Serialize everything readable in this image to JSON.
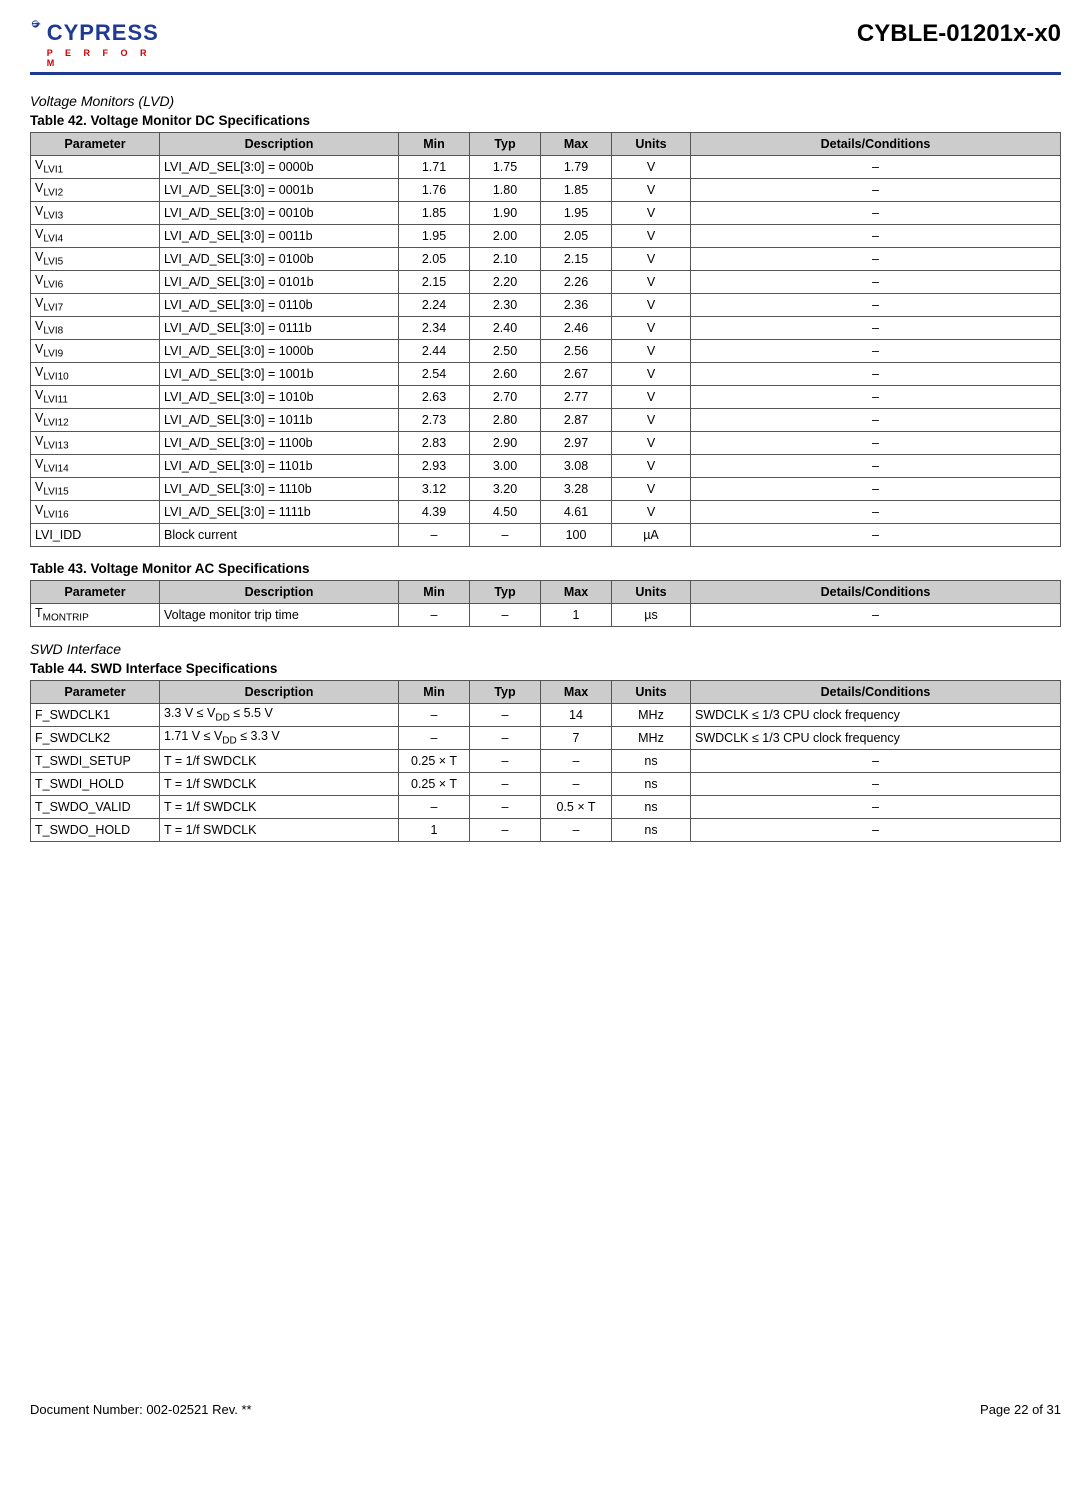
{
  "header": {
    "brand": "CYPRESS",
    "tagline": "P E R F O R M",
    "part": "CYBLE-01201x-x0"
  },
  "section1": {
    "heading": "Voltage Monitors (LVD)",
    "caption": "Table 42.  Voltage Monitor DC Specifications",
    "cols": [
      "Parameter",
      "Description",
      "Min",
      "Typ",
      "Max",
      "Units",
      "Details/Conditions"
    ],
    "rows": [
      {
        "pPre": "V",
        "pSub": "LVI1",
        "d": "LVI_A/D_SEL[3:0] = 0000b",
        "min": "1.71",
        "typ": "1.75",
        "max": "1.79",
        "u": "V",
        "c": "–"
      },
      {
        "pPre": "V",
        "pSub": "LVI2",
        "d": "LVI_A/D_SEL[3:0] = 0001b",
        "min": "1.76",
        "typ": "1.80",
        "max": "1.85",
        "u": "V",
        "c": "–"
      },
      {
        "pPre": "V",
        "pSub": "LVI3",
        "d": "LVI_A/D_SEL[3:0] = 0010b",
        "min": "1.85",
        "typ": "1.90",
        "max": "1.95",
        "u": "V",
        "c": "–"
      },
      {
        "pPre": "V",
        "pSub": "LVI4",
        "d": "LVI_A/D_SEL[3:0] = 0011b",
        "min": "1.95",
        "typ": "2.00",
        "max": "2.05",
        "u": "V",
        "c": "–"
      },
      {
        "pPre": "V",
        "pSub": "LVI5",
        "d": "LVI_A/D_SEL[3:0] = 0100b",
        "min": "2.05",
        "typ": "2.10",
        "max": "2.15",
        "u": "V",
        "c": "–"
      },
      {
        "pPre": "V",
        "pSub": "LVI6",
        "d": "LVI_A/D_SEL[3:0] = 0101b",
        "min": "2.15",
        "typ": "2.20",
        "max": "2.26",
        "u": "V",
        "c": "–"
      },
      {
        "pPre": "V",
        "pSub": "LVI7",
        "d": "LVI_A/D_SEL[3:0] = 0110b",
        "min": "2.24",
        "typ": "2.30",
        "max": "2.36",
        "u": "V",
        "c": "–"
      },
      {
        "pPre": "V",
        "pSub": "LVI8",
        "d": "LVI_A/D_SEL[3:0] = 0111b",
        "min": "2.34",
        "typ": "2.40",
        "max": "2.46",
        "u": "V",
        "c": "–"
      },
      {
        "pPre": "V",
        "pSub": "LVI9",
        "d": "LVI_A/D_SEL[3:0] = 1000b",
        "min": "2.44",
        "typ": "2.50",
        "max": "2.56",
        "u": "V",
        "c": "–"
      },
      {
        "pPre": "V",
        "pSub": "LVI10",
        "d": "LVI_A/D_SEL[3:0] = 1001b",
        "min": "2.54",
        "typ": "2.60",
        "max": "2.67",
        "u": "V",
        "c": "–"
      },
      {
        "pPre": "V",
        "pSub": "LVI11",
        "d": "LVI_A/D_SEL[3:0] = 1010b",
        "min": "2.63",
        "typ": "2.70",
        "max": "2.77",
        "u": "V",
        "c": "–"
      },
      {
        "pPre": "V",
        "pSub": "LVI12",
        "d": "LVI_A/D_SEL[3:0] = 1011b",
        "min": "2.73",
        "typ": "2.80",
        "max": "2.87",
        "u": "V",
        "c": "–"
      },
      {
        "pPre": "V",
        "pSub": "LVI13",
        "d": "LVI_A/D_SEL[3:0] = 1100b",
        "min": "2.83",
        "typ": "2.90",
        "max": "2.97",
        "u": "V",
        "c": "–"
      },
      {
        "pPre": "V",
        "pSub": "LVI14",
        "d": "LVI_A/D_SEL[3:0] = 1101b",
        "min": "2.93",
        "typ": "3.00",
        "max": "3.08",
        "u": "V",
        "c": "–"
      },
      {
        "pPre": "V",
        "pSub": "LVI15",
        "d": "LVI_A/D_SEL[3:0] = 1110b",
        "min": "3.12",
        "typ": "3.20",
        "max": "3.28",
        "u": "V",
        "c": "–"
      },
      {
        "pPre": "V",
        "pSub": "LVI16",
        "d": "LVI_A/D_SEL[3:0] = 1111b",
        "min": "4.39",
        "typ": "4.50",
        "max": "4.61",
        "u": "V",
        "c": "–"
      },
      {
        "pPre": "LVI_IDD",
        "pSub": "",
        "d": "Block current",
        "min": "–",
        "typ": "–",
        "max": "100",
        "u": "µA",
        "c": "–"
      }
    ]
  },
  "section2": {
    "caption": "Table 43.  Voltage Monitor AC Specifications",
    "cols": [
      "Parameter",
      "Description",
      "Min",
      "Typ",
      "Max",
      "Units",
      "Details/Conditions"
    ],
    "rows": [
      {
        "pPre": "T",
        "pSub": "MONTRIP",
        "d": "Voltage monitor trip time",
        "min": "–",
        "typ": "–",
        "max": "1",
        "u": "µs",
        "c": "–"
      }
    ]
  },
  "section3": {
    "heading": "SWD Interface",
    "caption": "Table 44.  SWD Interface Specifications",
    "cols": [
      "Parameter",
      "Description",
      "Min",
      "Typ",
      "Max",
      "Units",
      "Details/Conditions"
    ],
    "rows": [
      {
        "pPre": "F_SWDCLK1",
        "pSub": "",
        "dHtml": "3.3 V ≤ V<sub>DD</sub> ≤ 5.5 V",
        "min": "–",
        "typ": "–",
        "max": "14",
        "u": "MHz",
        "c": "SWDCLK ≤ 1/3 CPU clock frequency"
      },
      {
        "pPre": "F_SWDCLK2",
        "pSub": "",
        "dHtml": "1.71 V ≤ V<sub>DD</sub> ≤ 3.3 V",
        "min": "–",
        "typ": "–",
        "max": "7",
        "u": "MHz",
        "c": "SWDCLK ≤ 1/3 CPU clock frequency"
      },
      {
        "pPre": "T_SWDI_SETUP",
        "pSub": "",
        "d": "T = 1/f SWDCLK",
        "min": "0.25 × T",
        "typ": "–",
        "max": "–",
        "u": "ns",
        "c": "–"
      },
      {
        "pPre": "T_SWDI_HOLD",
        "pSub": "",
        "d": "T = 1/f SWDCLK",
        "min": "0.25 × T",
        "typ": "–",
        "max": "–",
        "u": "ns",
        "c": "–"
      },
      {
        "pPre": "T_SWDO_VALID",
        "pSub": "",
        "d": "T = 1/f SWDCLK",
        "min": "–",
        "typ": "–",
        "max": "0.5 × T",
        "u": "ns",
        "c": "–"
      },
      {
        "pPre": "T_SWDO_HOLD",
        "pSub": "",
        "d": "T = 1/f SWDCLK",
        "min": "1",
        "typ": "–",
        "max": "–",
        "u": "ns",
        "c": "–"
      }
    ]
  },
  "footer": {
    "doc": "Document Number: 002-02521 Rev. **",
    "page": "Page 22 of 31"
  }
}
